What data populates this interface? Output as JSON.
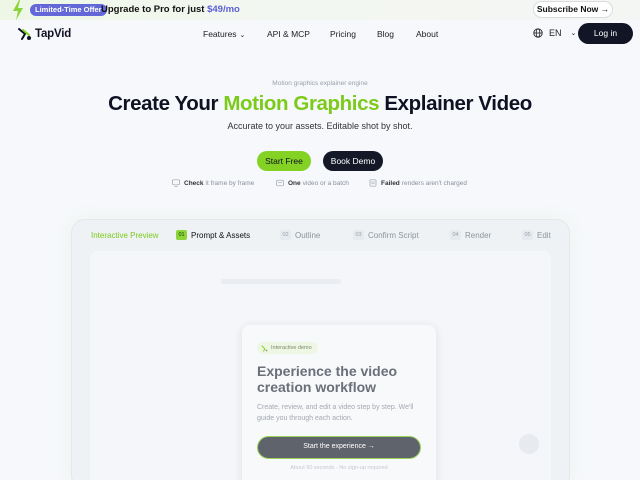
{
  "promo": {
    "badge": "Limited-Time Offer",
    "message_prefix": "Upgrade to Pro for just ",
    "price": "$49/mo",
    "cta": "Subscribe Now →"
  },
  "nav": {
    "brand": "TapVid",
    "items": [
      {
        "label": "Features",
        "has_dropdown": true
      },
      {
        "label": "API & MCP"
      },
      {
        "label": "Pricing"
      },
      {
        "label": "Blog"
      },
      {
        "label": "About"
      }
    ],
    "language": "EN",
    "login": "Log in"
  },
  "hero": {
    "eyebrow": "Motion graphics explainer engine",
    "title_before": "Create Your ",
    "title_highlight": "Motion Graphics",
    "title_after": " Explainer Video",
    "subtitle": "Accurate to your assets. Editable shot by shot.",
    "primary_cta": "Start Free",
    "secondary_cta": "Book Demo",
    "features": [
      {
        "bold": "Check",
        "rest": "it frame by frame",
        "icon": "monitor-icon"
      },
      {
        "bold": "One",
        "rest": "video or a batch",
        "icon": "layers-icon"
      },
      {
        "bold": "Failed",
        "rest": "renders aren't charged",
        "icon": "receipt-icon"
      }
    ]
  },
  "preview": {
    "label": "Interactive Preview",
    "steps": [
      {
        "num": "01",
        "label": "Prompt & Assets",
        "active": true
      },
      {
        "num": "02",
        "label": "Outline"
      },
      {
        "num": "03",
        "label": "Confirm Script"
      },
      {
        "num": "04",
        "label": "Render"
      },
      {
        "num": "05",
        "label": "Edit"
      }
    ],
    "card": {
      "badge": "Interactive demo",
      "title": "Experience the video creation workflow",
      "desc": "Create, review, and edit a video step by step. We'll guide you through each action.",
      "button": "Start the experience →",
      "fine_print": "About 90 seconds · No sign-up required"
    }
  },
  "colors": {
    "accent_green": "#84d224",
    "dark": "#121525",
    "promo_purple": "#6467d8"
  }
}
